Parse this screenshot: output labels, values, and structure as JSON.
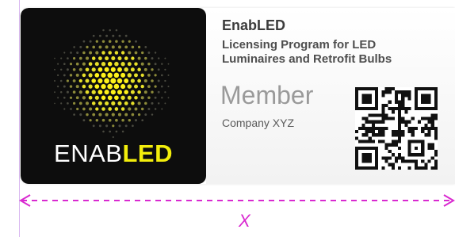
{
  "card": {
    "wordmark_light": "ENAB",
    "wordmark_bold": "LED",
    "brand_name": "EnabLED",
    "program_line1": "Licensing Program for LED",
    "program_line2": "Luminaires and Retrofit Bulbs",
    "member_title": "Member",
    "company_name": "Company XYZ"
  },
  "dimension": {
    "label": "X"
  },
  "colors": {
    "logo_background": "#0d0d0d",
    "logo_accent": "#f3ee0c",
    "dimension_line": "#d92ad0"
  },
  "icons": {
    "logo_mark": "hexagon-dot-burst",
    "qr": "qr-code"
  }
}
